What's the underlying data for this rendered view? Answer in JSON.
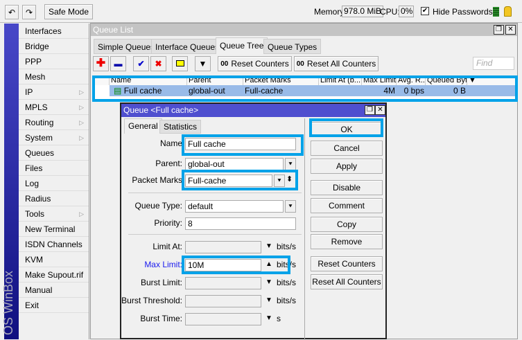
{
  "topbar": {
    "safe_mode": "Safe Mode",
    "memory_label": "Memory:",
    "memory_value": "978.0 MiB",
    "cpu_label": "CPU:",
    "cpu_value": "0%",
    "hide_passwords": "Hide Passwords",
    "hide_passwords_checked": true
  },
  "sidebar": {
    "brand": "OS WinBox",
    "items": [
      {
        "label": "Interfaces"
      },
      {
        "label": "Bridge"
      },
      {
        "label": "PPP"
      },
      {
        "label": "Mesh"
      },
      {
        "label": "IP",
        "submenu": true
      },
      {
        "label": "MPLS",
        "submenu": true
      },
      {
        "label": "Routing",
        "submenu": true
      },
      {
        "label": "System",
        "submenu": true
      },
      {
        "label": "Queues"
      },
      {
        "label": "Files"
      },
      {
        "label": "Log"
      },
      {
        "label": "Radius"
      },
      {
        "label": "Tools",
        "submenu": true
      },
      {
        "label": "New Terminal"
      },
      {
        "label": "ISDN Channels"
      },
      {
        "label": "KVM"
      },
      {
        "label": "Make Supout.rif"
      },
      {
        "label": "Manual"
      },
      {
        "label": "Exit"
      }
    ]
  },
  "queue_list": {
    "title": "Queue List",
    "tabs": [
      "Simple Queues",
      "Interface Queues",
      "Queue Tree",
      "Queue Types"
    ],
    "active_tab": "Queue Tree",
    "reset_counters": "Reset Counters",
    "reset_all_counters": "Reset All Counters",
    "find_placeholder": "Find",
    "columns": [
      "Name",
      "Parent",
      "Packet Marks",
      "Limit At (b...",
      "Max Limit ...",
      "Avg. R...",
      "Queued Bytes"
    ],
    "rows": [
      {
        "name": "Full cache",
        "parent": "global-out",
        "packet_marks": "Full-cache",
        "limit_at": "",
        "max_limit": "4M",
        "avg_rate": "0 bps",
        "queued_bytes": "0 B"
      }
    ]
  },
  "dialog": {
    "title": "Queue <Full cache>",
    "tabs": [
      "General",
      "Statistics"
    ],
    "fields": {
      "name_label": "Name",
      "name": "Full cache",
      "parent_label": "Parent:",
      "parent": "global-out",
      "packet_marks_label": "Packet Marks",
      "packet_marks": "Full-cache",
      "queue_type_label": "Queue Type:",
      "queue_type": "default",
      "priority_label": "Priority:",
      "priority": "8",
      "limit_at_label": "Limit At:",
      "limit_at": "",
      "max_limit_label": "Max Limit:",
      "max_limit": "10M",
      "burst_limit_label": "Burst Limit:",
      "burst_limit": "",
      "burst_threshold_label": "Burst Threshold:",
      "burst_threshold": "",
      "burst_time_label": "Burst Time:",
      "burst_time": "",
      "bits_unit": "bits/s",
      "s_unit": "s"
    },
    "buttons": [
      "OK",
      "Cancel",
      "Apply",
      "Disable",
      "Comment",
      "Copy",
      "Remove",
      "Reset Counters",
      "Reset All Counters"
    ]
  },
  "colors": {
    "highlight": "#00a2e8",
    "selected_row": "#99bbe8",
    "dialog_title": "#4f4fcf"
  }
}
